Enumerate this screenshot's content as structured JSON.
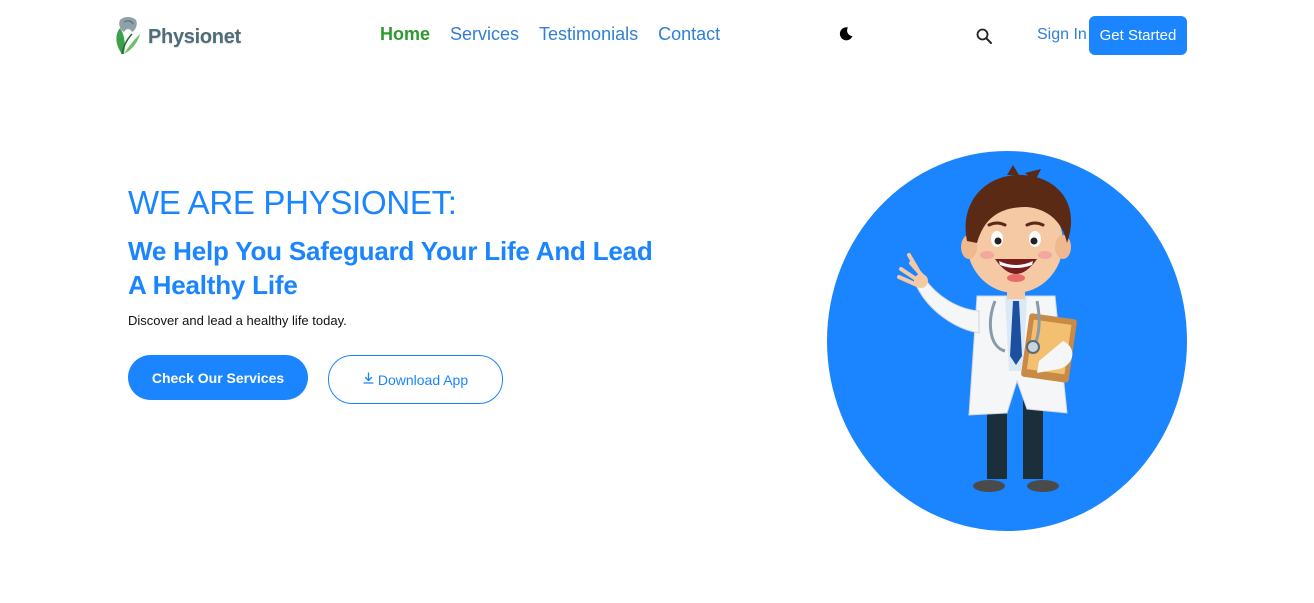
{
  "brand": {
    "name": "Physionet",
    "logo_icon": "leaf-tooth-icon"
  },
  "nav": {
    "links": [
      {
        "label": "Home",
        "active": true
      },
      {
        "label": "Services",
        "active": false
      },
      {
        "label": "Testimonials",
        "active": false
      },
      {
        "label": "Contact",
        "active": false
      }
    ],
    "theme_toggle_icon": "moon-icon",
    "search_icon": "search-icon",
    "signin_label": "Sign In",
    "cta_label": "Get Started"
  },
  "hero": {
    "title": "WE ARE PHYSIONET:",
    "subtitle": "We Help You Safeguard Your Life And Lead A Healthy Life",
    "description": "Discover and lead a healthy life today.",
    "primary_button": "Check Our Services",
    "secondary_button": "Download App",
    "secondary_icon": "download-icon",
    "illustration": "doctor-cartoon-illustration"
  },
  "colors": {
    "accent": "#1a85ff",
    "link": "#2f7ed8",
    "active_link": "#2e9a2e",
    "background": "#ffffff"
  }
}
